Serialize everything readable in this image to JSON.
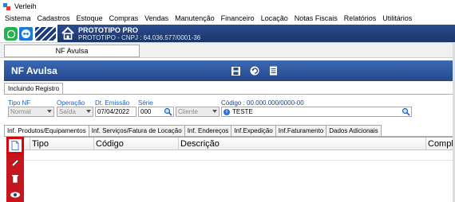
{
  "window": {
    "title": "Verleih"
  },
  "menu": [
    "Sistema",
    "Cadastros",
    "Estoque",
    "Compras",
    "Vendas",
    "Manutenção",
    "Financeiro",
    "Locação",
    "Notas Fiscais",
    "Relatórios",
    "Utilitários"
  ],
  "company": {
    "name": "PROTOTIPO PRO",
    "cnpj": "PROTOTIPO - CNPJ : 64.036.577/0001-36"
  },
  "doc_tab": {
    "label": "NF Avulsa"
  },
  "form": {
    "title": "NF Avulsa",
    "subtab": "Incluindo Registro"
  },
  "fields": {
    "tipo_nf": {
      "label": "Tipo NF",
      "value": "Normal"
    },
    "operacao": {
      "label": "Operação",
      "value": "Saída"
    },
    "dt_emissao": {
      "label": "Dt. Emissão",
      "value": "07/04/2022"
    },
    "serie": {
      "label": "Série",
      "value": "000"
    },
    "cliente": {
      "value": "Cliente"
    },
    "codigo": {
      "label": "Código : 00.000.000/0000-00",
      "value": "TESTE"
    }
  },
  "tabs": [
    "Inf. Produtos/Equipamentos",
    "Inf. Serviços/Fatura de Locação",
    "Inf. Endereços",
    "Inf.Expedição",
    "Inf.Faturamento",
    "Dados Adicionais"
  ],
  "grid": {
    "columns": [
      "Tipo",
      "Código",
      "Descrição",
      "Complem"
    ]
  },
  "icons": {
    "whatsapp": "whatsapp-icon",
    "teamviewer": "teamviewer-icon",
    "home": "home-icon",
    "save": "save-icon",
    "undo": "undo-icon",
    "doc": "document-icon",
    "new": "new-document-icon",
    "edit": "pencil-icon",
    "delete": "delete-icon",
    "view": "eye-icon"
  },
  "colors": {
    "accent_blue": "#2a4d8f",
    "sidebar_red": "#c4161c",
    "label_blue": "#1f5fb5"
  }
}
